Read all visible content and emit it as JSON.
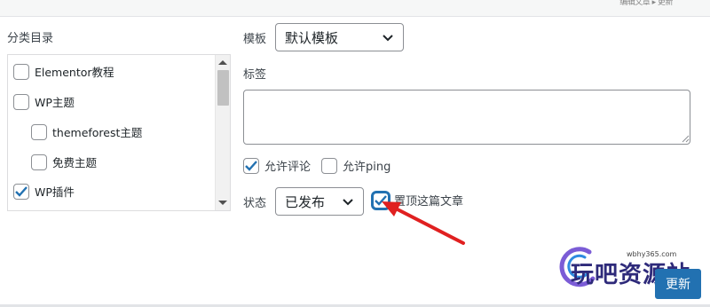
{
  "header": {
    "meta_text": "编辑文章 ▸ 更新"
  },
  "categories": {
    "title": "分类目录",
    "items": [
      {
        "label": "Elementor教程",
        "checked": false
      },
      {
        "label": "WP主题",
        "checked": false
      },
      {
        "label": "themeforest主题",
        "checked": false
      },
      {
        "label": "免费主题",
        "checked": false
      },
      {
        "label": "WP插件",
        "checked": true
      }
    ]
  },
  "template": {
    "label": "模板",
    "value": "默认模板"
  },
  "tags": {
    "label": "标签",
    "value": ""
  },
  "discussion": {
    "allow_comments": {
      "label": "允许评论",
      "checked": true
    },
    "allow_pings": {
      "label": "允许ping",
      "checked": false
    }
  },
  "status": {
    "label": "状态",
    "value": "已发布"
  },
  "sticky": {
    "label": "置顶这篇文章",
    "checked": true
  },
  "update_button": "更新",
  "watermark": {
    "url": "wbhy365.com",
    "text": "玩吧资源站"
  },
  "colors": {
    "accent": "#2271b1",
    "arrow": "#e02020",
    "checkbox_check": "#2271b1"
  }
}
